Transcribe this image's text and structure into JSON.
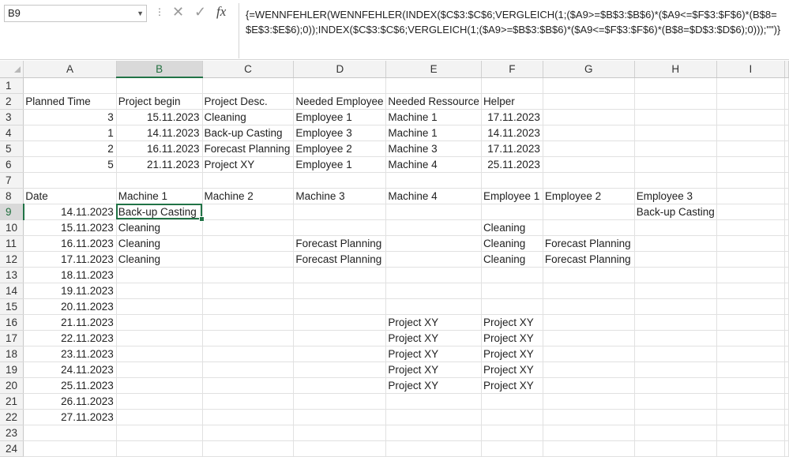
{
  "formula_bar": {
    "name_box": "B9",
    "formula": "{=WENNFEHLER(WENNFEHLER(INDEX($C$3:$C$6;VERGLEICH(1;($A9>=$B$3:$B$6)*($A9<=$F$3:$F$6)*(B$8=$E$3:$E$6);0));INDEX($C$3:$C$6;VERGLEICH(1;($A9>=$B$3:$B$6)*($A9<=$F$3:$F$6)*(B$8=$D$3:$D$6);0)));\"\")}"
  },
  "icons": {
    "cancel": "close-icon",
    "enter": "check-icon",
    "function": "fx-icon",
    "dropdown": "chevron-down-icon"
  },
  "columns": [
    "A",
    "B",
    "C",
    "D",
    "E",
    "F",
    "G",
    "H",
    "I"
  ],
  "selected_cell": {
    "column": "B",
    "row": 9
  },
  "rows": [
    {
      "n": "1",
      "A": "",
      "B": "",
      "C": "",
      "D": "",
      "E": "",
      "F": "",
      "G": "",
      "H": "",
      "I": ""
    },
    {
      "n": "2",
      "A": "Planned Time",
      "B": "Project begin",
      "C": "Project Desc.",
      "D": "Needed Employee",
      "E": "Needed Ressource",
      "F": "Helper",
      "G": "",
      "H": "",
      "I": ""
    },
    {
      "n": "3",
      "A": "3",
      "B": "15.11.2023",
      "C": "Cleaning",
      "D": "Employee 1",
      "E": "Machine 1",
      "F": "17.11.2023",
      "G": "",
      "H": "",
      "I": ""
    },
    {
      "n": "4",
      "A": "1",
      "B": "14.11.2023",
      "C": "Back-up Casting",
      "D": "Employee 3",
      "E": "Machine 1",
      "F": "14.11.2023",
      "G": "",
      "H": "",
      "I": ""
    },
    {
      "n": "5",
      "A": "2",
      "B": "16.11.2023",
      "C": "Forecast Planning",
      "D": "Employee 2",
      "E": "Machine 3",
      "F": "17.11.2023",
      "G": "",
      "H": "",
      "I": ""
    },
    {
      "n": "6",
      "A": "5",
      "B": "21.11.2023",
      "C": "Project XY",
      "D": "Employee 1",
      "E": "Machine 4",
      "F": "25.11.2023",
      "G": "",
      "H": "",
      "I": ""
    },
    {
      "n": "7",
      "A": "",
      "B": "",
      "C": "",
      "D": "",
      "E": "",
      "F": "",
      "G": "",
      "H": "",
      "I": ""
    },
    {
      "n": "8",
      "A": "Date",
      "B": "Machine 1",
      "C": "Machine 2",
      "D": "Machine 3",
      "E": "Machine 4",
      "F": "Employee 1",
      "G": "Employee 2",
      "H": "Employee 3",
      "I": ""
    },
    {
      "n": "9",
      "A": "14.11.2023",
      "B": "Back-up Casting",
      "C": "",
      "D": "",
      "E": "",
      "F": "",
      "G": "",
      "H": "Back-up Casting",
      "I": ""
    },
    {
      "n": "10",
      "A": "15.11.2023",
      "B": "Cleaning",
      "C": "",
      "D": "",
      "E": "",
      "F": "Cleaning",
      "G": "",
      "H": "",
      "I": ""
    },
    {
      "n": "11",
      "A": "16.11.2023",
      "B": "Cleaning",
      "C": "",
      "D": "Forecast Planning",
      "E": "",
      "F": "Cleaning",
      "G": "Forecast Planning",
      "H": "",
      "I": ""
    },
    {
      "n": "12",
      "A": "17.11.2023",
      "B": "Cleaning",
      "C": "",
      "D": "Forecast Planning",
      "E": "",
      "F": "Cleaning",
      "G": "Forecast Planning",
      "H": "",
      "I": ""
    },
    {
      "n": "13",
      "A": "18.11.2023",
      "B": "",
      "C": "",
      "D": "",
      "E": "",
      "F": "",
      "G": "",
      "H": "",
      "I": ""
    },
    {
      "n": "14",
      "A": "19.11.2023",
      "B": "",
      "C": "",
      "D": "",
      "E": "",
      "F": "",
      "G": "",
      "H": "",
      "I": ""
    },
    {
      "n": "15",
      "A": "20.11.2023",
      "B": "",
      "C": "",
      "D": "",
      "E": "",
      "F": "",
      "G": "",
      "H": "",
      "I": ""
    },
    {
      "n": "16",
      "A": "21.11.2023",
      "B": "",
      "C": "",
      "D": "",
      "E": "Project XY",
      "F": "Project XY",
      "G": "",
      "H": "",
      "I": ""
    },
    {
      "n": "17",
      "A": "22.11.2023",
      "B": "",
      "C": "",
      "D": "",
      "E": "Project XY",
      "F": "Project XY",
      "G": "",
      "H": "",
      "I": ""
    },
    {
      "n": "18",
      "A": "23.11.2023",
      "B": "",
      "C": "",
      "D": "",
      "E": "Project XY",
      "F": "Project XY",
      "G": "",
      "H": "",
      "I": ""
    },
    {
      "n": "19",
      "A": "24.11.2023",
      "B": "",
      "C": "",
      "D": "",
      "E": "Project XY",
      "F": "Project XY",
      "G": "",
      "H": "",
      "I": ""
    },
    {
      "n": "20",
      "A": "25.11.2023",
      "B": "",
      "C": "",
      "D": "",
      "E": "Project XY",
      "F": "Project XY",
      "G": "",
      "H": "",
      "I": ""
    },
    {
      "n": "21",
      "A": "26.11.2023",
      "B": "",
      "C": "",
      "D": "",
      "E": "",
      "F": "",
      "G": "",
      "H": "",
      "I": ""
    },
    {
      "n": "22",
      "A": "27.11.2023",
      "B": "",
      "C": "",
      "D": "",
      "E": "",
      "F": "",
      "G": "",
      "H": "",
      "I": ""
    },
    {
      "n": "23",
      "A": "",
      "B": "",
      "C": "",
      "D": "",
      "E": "",
      "F": "",
      "G": "",
      "H": "",
      "I": ""
    },
    {
      "n": "24",
      "A": "",
      "B": "",
      "C": "",
      "D": "",
      "E": "",
      "F": "",
      "G": "",
      "H": "",
      "I": ""
    }
  ],
  "numeric_cells": [
    "A3",
    "A4",
    "A5",
    "A6",
    "B3",
    "B4",
    "B5",
    "B6",
    "F3",
    "F4",
    "F5",
    "F6",
    "A9",
    "A10",
    "A11",
    "A12",
    "A13",
    "A14",
    "A15",
    "A16",
    "A17",
    "A18",
    "A19",
    "A20",
    "A21",
    "A22"
  ]
}
